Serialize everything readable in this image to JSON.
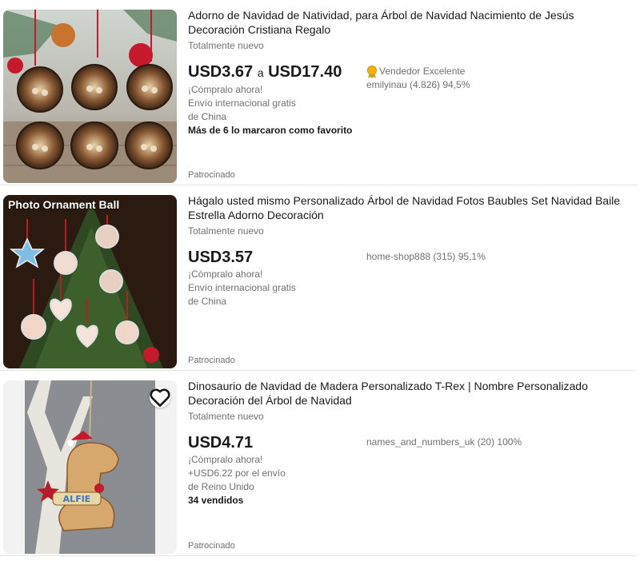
{
  "listings": [
    {
      "title": "Adorno de Navidad de Natividad, para Árbol de Navidad Nacimiento de Jesús Decoración Cristiana Regalo",
      "condition": "Totalmente nuevo",
      "price_low": "USD3.67",
      "price_sep": "a",
      "price_high": "USD17.40",
      "buy_now": "¡Cómpralo ahora!",
      "shipping_line1": "Envío internacional gratis",
      "shipping_line2": "de China",
      "extra": "Más de 6 lo marcaron como favorito",
      "top_rated": "Vendedor Excelente",
      "seller": "emilyinau (4.826) 94,5%",
      "sponsored": "Patrocinado",
      "image": "nativity-ornaments-photo"
    },
    {
      "title": "Hágalo usted mismo Personalizado Árbol de Navidad Fotos Baubles Set Navidad Baile Estrella Adorno Decoración",
      "condition": "Totalmente nuevo",
      "price": "USD3.57",
      "buy_now": "¡Cómpralo ahora!",
      "shipping_line1": "Envío internacional gratis",
      "shipping_line2": "de China",
      "seller": "home-shop888 (315) 95,1%",
      "sponsored": "Patrocinado",
      "image_caption": "Photo Ornament Ball",
      "image": "photo-ornament-tree"
    },
    {
      "title": "Dinosaurio de Navidad de Madera Personalizado T-Rex | Nombre Personalizado Decoración del Árbol de Navidad",
      "condition": "Totalmente nuevo",
      "price": "USD4.71",
      "buy_now": "¡Cómpralo ahora!",
      "shipping_line1": "+USD6.22 por el envío",
      "shipping_line2": "de Reino Unido",
      "extra": "34 vendidos",
      "seller": "names_and_numbers_uk (20) 100%",
      "sponsored": "Patrocinado",
      "image_name_tag": "ALFIE",
      "image": "wooden-dino-ornament",
      "favorite_icon": "heart-icon"
    }
  ],
  "colors": {
    "text": "#191919",
    "muted": "#707070",
    "divider": "#e5e5e5",
    "badge": "#f2b400"
  }
}
